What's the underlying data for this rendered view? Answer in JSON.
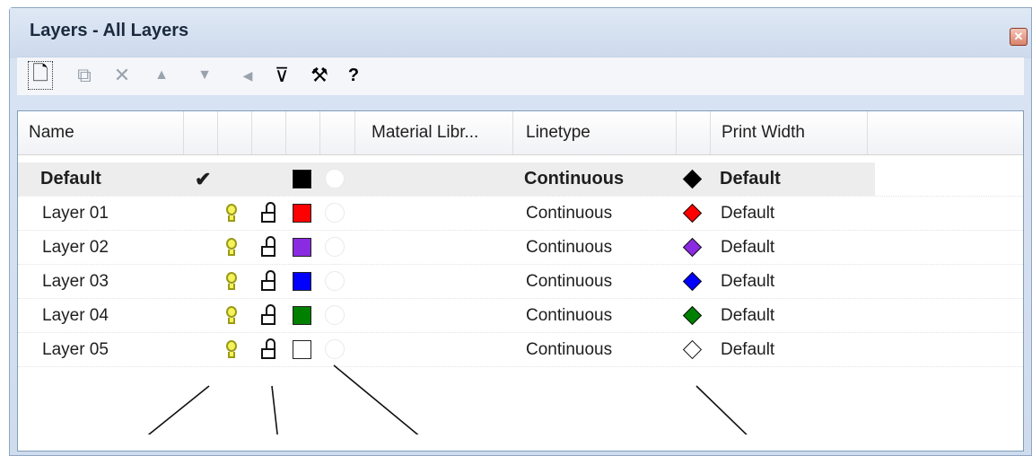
{
  "window": {
    "title": "Layers - All Layers",
    "close_glyph": "✕"
  },
  "toolbar": {
    "items": [
      {
        "name": "new-layer-icon",
        "glyph": "🗋"
      },
      {
        "name": "copy-layer-icon",
        "glyph": "⧉"
      },
      {
        "name": "delete-icon",
        "glyph": "✕"
      },
      {
        "name": "move-up-icon",
        "glyph": "▲"
      },
      {
        "name": "move-down-icon",
        "glyph": "▼"
      },
      {
        "name": "move-left-icon",
        "glyph": "◀"
      },
      {
        "name": "filter-icon",
        "glyph": "⊽"
      },
      {
        "name": "tools-icon",
        "glyph": "⚒"
      },
      {
        "name": "help-icon",
        "glyph": "?"
      }
    ]
  },
  "columns": {
    "name": "Name",
    "material": "Material Libr...",
    "linetype": "Linetype",
    "print_width": "Print Width"
  },
  "rows": [
    {
      "name": "Default",
      "current_mark": "✔",
      "color": "#000000",
      "linetype": "Continuous",
      "print_color": "#000000",
      "print_width": "Default"
    },
    {
      "name": "Layer 01",
      "color": "#ff0000",
      "linetype": "Continuous",
      "print_color": "#ff0000",
      "print_width": "Default"
    },
    {
      "name": "Layer 02",
      "color": "#8a2be2",
      "linetype": "Continuous",
      "print_color": "#8a2be2",
      "print_width": "Default"
    },
    {
      "name": "Layer 03",
      "color": "#0000ff",
      "linetype": "Continuous",
      "print_color": "#0000ff",
      "print_width": "Default"
    },
    {
      "name": "Layer 04",
      "color": "#008000",
      "linetype": "Continuous",
      "print_color": "#008000",
      "print_width": "Default"
    },
    {
      "name": "Layer 05",
      "color": "#ffffff",
      "linetype": "Continuous",
      "print_color": "#ffffff",
      "print_width": "Default"
    }
  ]
}
